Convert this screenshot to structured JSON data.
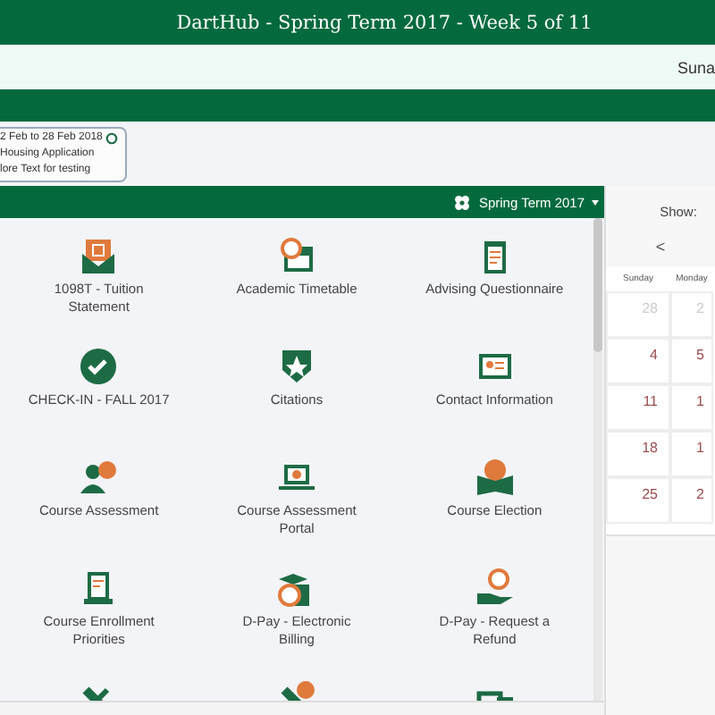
{
  "header": {
    "title": "DartHub - Spring Term 2017 - Week 5 of 11"
  },
  "user_bar": {
    "user": "Suna"
  },
  "notice": {
    "lines": [
      "2 Feb to 28 Feb 2018",
      "Housing Application",
      "lore Text for testing"
    ]
  },
  "apps_panel": {
    "term": "Spring Term 2017",
    "tiles": [
      {
        "label": "1098T - Tuition Statement"
      },
      {
        "label": "Academic Timetable"
      },
      {
        "label": "Advising Questionnaire"
      },
      {
        "label": "CHECK-IN - FALL 2017"
      },
      {
        "label": "Citations"
      },
      {
        "label": "Contact Information"
      },
      {
        "label": "Course Assessment"
      },
      {
        "label": "Course Assessment Portal"
      },
      {
        "label": "Course Election"
      },
      {
        "label": "Course Enrollment Priorities"
      },
      {
        "label": "D-Pay - Electronic Billing"
      },
      {
        "label": "D-Pay - Request a Refund"
      }
    ]
  },
  "calendar": {
    "show_label": "Show:",
    "prev": "<",
    "weekdays": [
      "Sunday",
      "Monday"
    ],
    "weeks": [
      {
        "days": [
          "28",
          "2"
        ],
        "muted": true
      },
      {
        "days": [
          "4",
          "5"
        ],
        "muted": false
      },
      {
        "days": [
          "11",
          "1"
        ],
        "muted": false
      },
      {
        "days": [
          "18",
          "1"
        ],
        "muted": false
      },
      {
        "days": [
          "25",
          "2"
        ],
        "muted": false
      }
    ]
  }
}
